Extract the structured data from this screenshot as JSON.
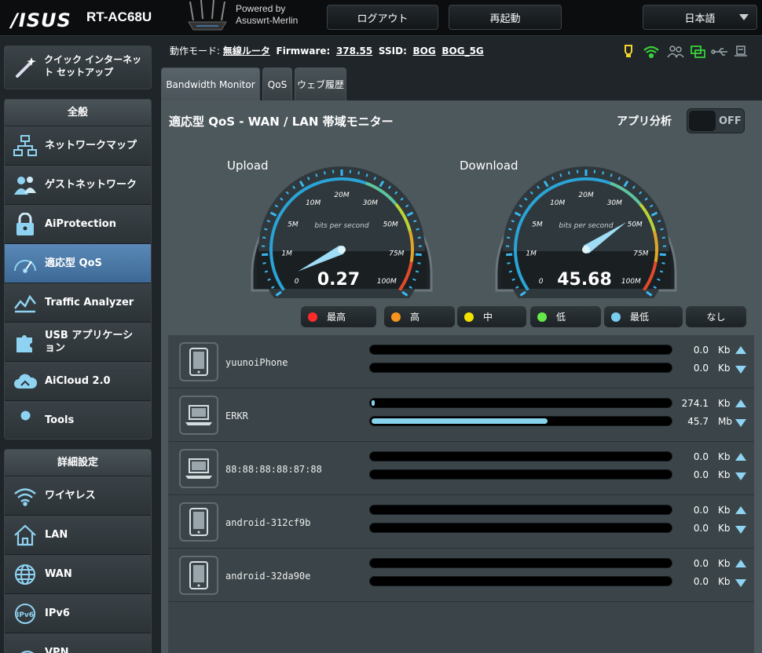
{
  "header": {
    "logo": "/ISUS",
    "model": "RT-AC68U",
    "powered_line1": "Powered by",
    "powered_line2": "Asuswrt-Merlin",
    "logout_label": "ログアウト",
    "reboot_label": "再起動",
    "language": "日本語"
  },
  "sidebar": {
    "quick_setup": "クイック インターネット セットアップ",
    "general_title": "全般",
    "general_items": [
      {
        "label": "ネットワークマップ",
        "icon": "network-map-icon"
      },
      {
        "label": "ゲストネットワーク",
        "icon": "guest-network-icon"
      },
      {
        "label": "AiProtection",
        "icon": "lock-icon"
      },
      {
        "label": "適応型 QoS",
        "icon": "speedometer-icon",
        "active": true
      },
      {
        "label": "Traffic Analyzer",
        "icon": "traffic-analyzer-icon"
      },
      {
        "label": "USB アプリケーション",
        "icon": "puzzle-icon"
      },
      {
        "label": "AiCloud 2.0",
        "icon": "cloud-icon"
      },
      {
        "label": "Tools",
        "icon": "wrench-icon"
      }
    ],
    "advanced_title": "詳細設定",
    "advanced_items": [
      {
        "label": "ワイヤレス",
        "icon": "wifi-icon"
      },
      {
        "label": "LAN",
        "icon": "home-icon"
      },
      {
        "label": "WAN",
        "icon": "globe-icon"
      },
      {
        "label": "IPv6",
        "icon": "ipv6-icon"
      },
      {
        "label": "VPN",
        "icon": "vpn-icon"
      }
    ]
  },
  "status": {
    "mode_label": "動作モード:",
    "mode_value": "無線ルータ",
    "firmware_label": "Firmware:",
    "firmware_value": "378.55",
    "ssid_label": "SSID:",
    "ssid1": "BOG",
    "ssid2": "BOG_5G"
  },
  "tabs": [
    "Bandwidth Monitor",
    "QoS",
    "ウェブ履歴"
  ],
  "panel": {
    "title": "適応型 QoS - WAN / LAN 帯域モニター",
    "app_analysis_label": "アプリ分析",
    "app_analysis_state": "OFF"
  },
  "gauges": {
    "upload": {
      "label": "Upload",
      "value": "0.27",
      "mbps": 0.27
    },
    "download": {
      "label": "Download",
      "value": "45.68",
      "mbps": 45.68
    },
    "unit_text": "bits per second",
    "ticks": [
      "0",
      "1M",
      "5M",
      "10M",
      "20M",
      "30M",
      "50M",
      "75M",
      "100M"
    ]
  },
  "legend": [
    {
      "label": "最高",
      "color": "#ff2a2a"
    },
    {
      "label": "高",
      "color": "#f7941d"
    },
    {
      "label": "中",
      "color": "#f2e200"
    },
    {
      "label": "低",
      "color": "#66e84a"
    },
    {
      "label": "最低",
      "color": "#78cdf0"
    },
    {
      "label": "なし",
      "color": ""
    }
  ],
  "clients": [
    {
      "name": "yuunoiPhone",
      "device": "phone",
      "up_value": "0.0",
      "up_unit": "Kb",
      "down_value": "0.0",
      "down_unit": "Kb",
      "up_fill": 0,
      "down_fill": 0
    },
    {
      "name": "ERKR",
      "device": "laptop",
      "up_value": "274.1",
      "up_unit": "Kb",
      "down_value": "45.7",
      "down_unit": "Mb",
      "up_fill": 0.008,
      "down_fill": 0.59
    },
    {
      "name": "88:88:88:88:87:88",
      "device": "laptop",
      "up_value": "0.0",
      "up_unit": "Kb",
      "down_value": "0.0",
      "down_unit": "Kb",
      "up_fill": 0,
      "down_fill": 0
    },
    {
      "name": "android-312cf9b",
      "device": "phone",
      "up_value": "0.0",
      "up_unit": "Kb",
      "down_value": "0.0",
      "down_unit": "Kb",
      "up_fill": 0,
      "down_fill": 0
    },
    {
      "name": "android-32da90e",
      "device": "phone",
      "up_value": "0.0",
      "up_unit": "Kb",
      "down_value": "0.0",
      "down_unit": "Kb",
      "up_fill": 0,
      "down_fill": 0
    }
  ]
}
